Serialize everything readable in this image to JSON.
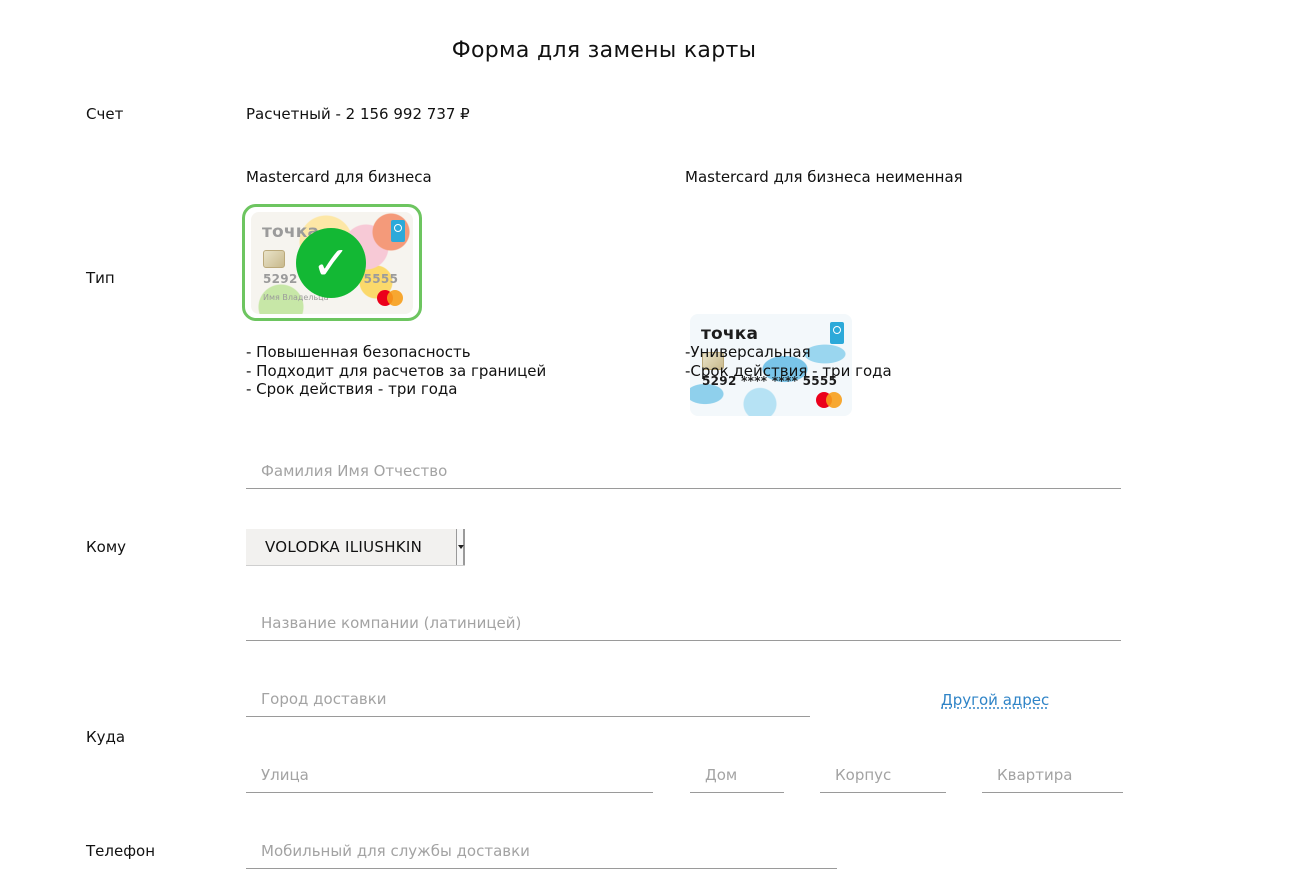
{
  "title": "Форма для замены карты",
  "account": {
    "label": "Счет",
    "value": "Расчетный - 2 156 992 737 ₽"
  },
  "type": {
    "label": "Тип",
    "options": [
      {
        "name": "Mastercard для бизнеса",
        "selected": true,
        "card": {
          "logo": "точка",
          "number": "5292 **** **** 5555",
          "holder": "Имя Владельца"
        },
        "features": [
          "- Повышенная безопасность",
          "- Подходит для расчетов за границей",
          "- Срок действия - три года"
        ]
      },
      {
        "name": "Mastercard для бизнеса неименная",
        "selected": false,
        "card": {
          "logo": "точка",
          "number": "5292 **** **** 5555"
        },
        "features": [
          "-Универсальная",
          "-Срок действия - три года"
        ]
      }
    ],
    "check_icon": "check-icon"
  },
  "recipient": {
    "label": "Кому",
    "fio_placeholder": "Фамилия Имя Отчество",
    "embossed_name": "VOLODKA ILIUSHKIN",
    "company_placeholder": "Название компании (латиницей)"
  },
  "address": {
    "label": "Куда",
    "city_placeholder": "Город доставки",
    "other_address_link": "Другой адрес",
    "street_placeholder": "Улица",
    "house_placeholder": "Дом",
    "building_placeholder": "Корпус",
    "apartment_placeholder": "Квартира"
  },
  "phone": {
    "label": "Телефон",
    "placeholder": "Мобильный для службы доставки"
  },
  "colors": {
    "accent_green": "#13b834",
    "selection_border": "#6dc560",
    "link_blue": "#2f84c7"
  }
}
